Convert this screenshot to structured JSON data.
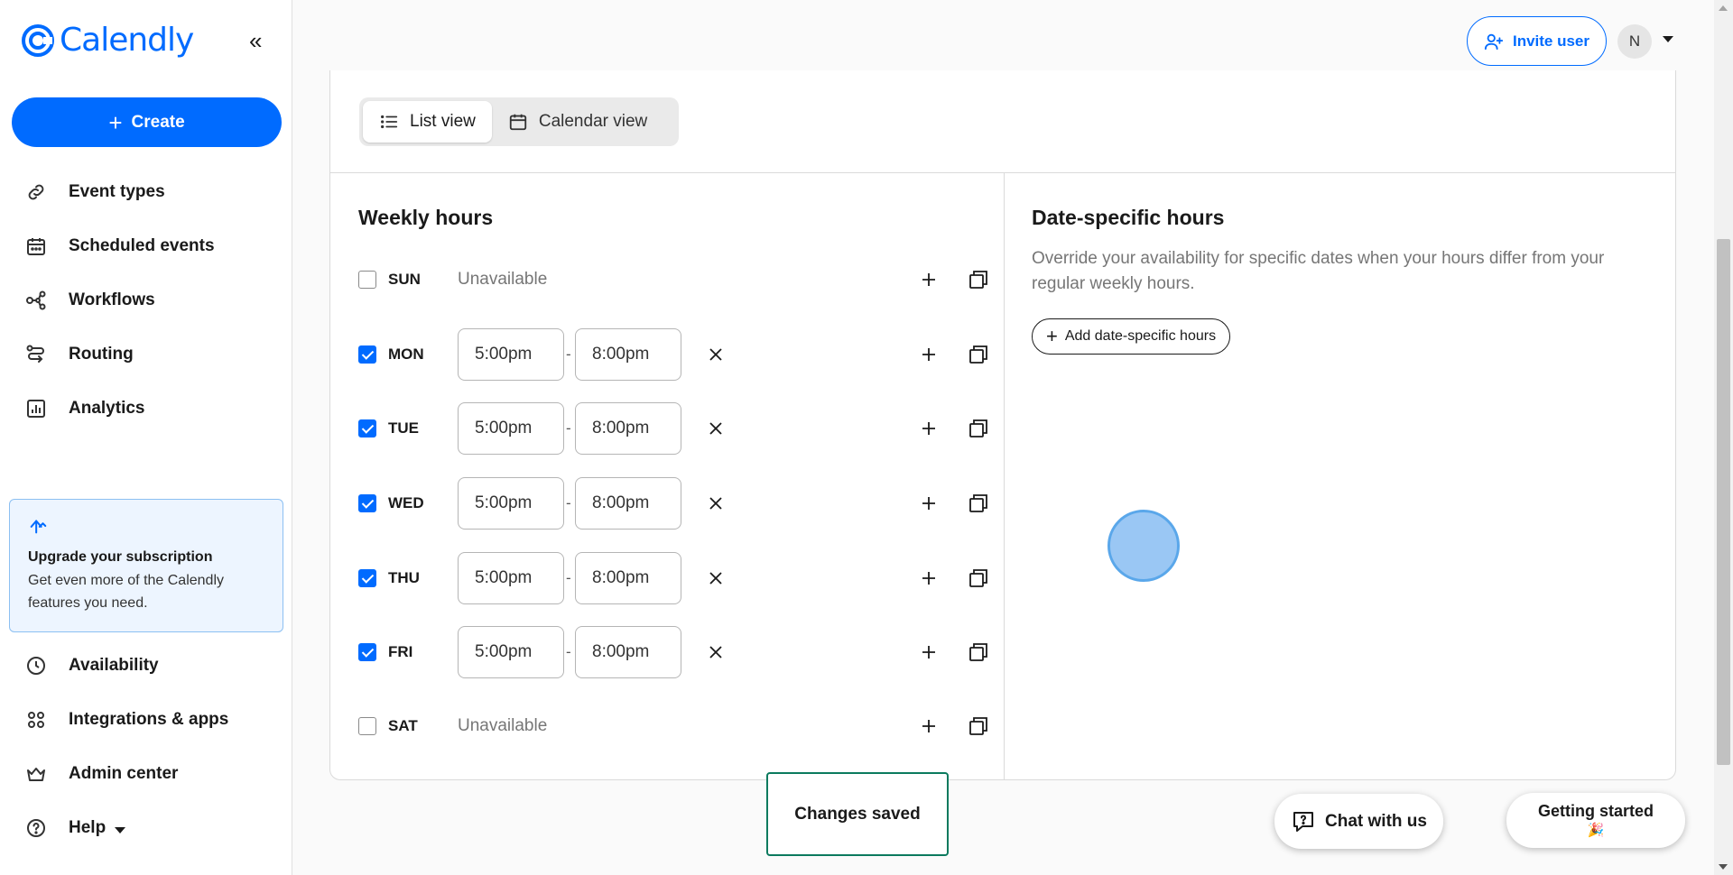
{
  "brand": {
    "name": "Calendly",
    "accent": "#006bff"
  },
  "sidebar": {
    "collapse_icon": "double-chevron-left-icon",
    "create_label": "Create",
    "nav_top": [
      {
        "label": "Event types",
        "icon": "link-icon"
      },
      {
        "label": "Scheduled events",
        "icon": "calendar-icon"
      },
      {
        "label": "Workflows",
        "icon": "workflow-icon"
      },
      {
        "label": "Routing",
        "icon": "routing-icon"
      },
      {
        "label": "Analytics",
        "icon": "analytics-icon"
      }
    ],
    "upgrade": {
      "title": "Upgrade your subscription",
      "text": "Get even more of the Calendly features you need."
    },
    "nav_bottom": [
      {
        "label": "Availability",
        "icon": "clock-icon"
      },
      {
        "label": "Integrations & apps",
        "icon": "apps-grid-icon"
      },
      {
        "label": "Admin center",
        "icon": "crown-icon"
      },
      {
        "label": "Help",
        "icon": "help-icon"
      }
    ]
  },
  "header": {
    "invite_label": "Invite user",
    "avatar_initial": "N"
  },
  "view_toggle": {
    "list_label": "List view",
    "calendar_label": "Calendar view",
    "active": "List view"
  },
  "weekly": {
    "title": "Weekly hours",
    "unavailable_text": "Unavailable",
    "days": [
      {
        "day": "SUN",
        "checked": false,
        "start": "",
        "end": ""
      },
      {
        "day": "MON",
        "checked": true,
        "start": "5:00pm",
        "end": "8:00pm"
      },
      {
        "day": "TUE",
        "checked": true,
        "start": "5:00pm",
        "end": "8:00pm"
      },
      {
        "day": "WED",
        "checked": true,
        "start": "5:00pm",
        "end": "8:00pm"
      },
      {
        "day": "THU",
        "checked": true,
        "start": "5:00pm",
        "end": "8:00pm"
      },
      {
        "day": "FRI",
        "checked": true,
        "start": "5:00pm",
        "end": "8:00pm"
      },
      {
        "day": "SAT",
        "checked": false,
        "start": "",
        "end": ""
      }
    ]
  },
  "date_specific": {
    "title": "Date-specific hours",
    "description": "Override your availability for specific dates when your hours differ from your regular weekly hours.",
    "add_label": "Add date-specific hours"
  },
  "toast": {
    "text": "Changes saved"
  },
  "chat": {
    "label": "Chat with us"
  },
  "getting_started": {
    "label": "Getting started",
    "emoji": "🎉"
  }
}
